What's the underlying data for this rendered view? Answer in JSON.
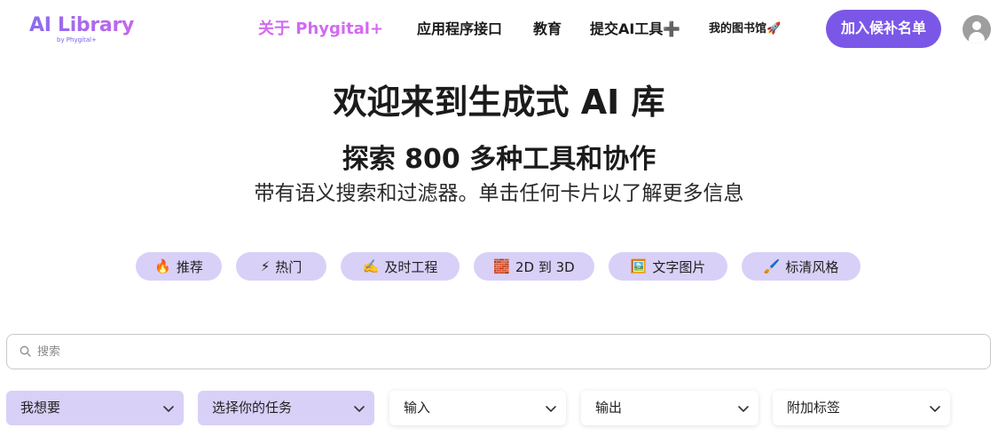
{
  "logo": {
    "title": "AI Library",
    "subtitle": "by Phygital+"
  },
  "nav": {
    "about": "关于 Phygital+",
    "api": "应用程序接口",
    "education": "教育",
    "submit": "提交AI工具",
    "submit_icon": "➕",
    "my_library": "我的图书馆",
    "my_library_icon": "🚀"
  },
  "join_button": "加入候补名单",
  "hero": {
    "title": "欢迎来到生成式 AI 库",
    "subtitle": "探索 800 多种工具和协作",
    "description": "带有语义搜索和过滤器。单击任何卡片以了解更多信息"
  },
  "chips": [
    {
      "icon": "🔥",
      "label": "推荐"
    },
    {
      "icon": "⚡",
      "label": "热门"
    },
    {
      "icon": "✍️",
      "label": "及时工程"
    },
    {
      "icon": "🧱",
      "label": "2D 到 3D"
    },
    {
      "icon": "🖼️",
      "label": "文字图片"
    },
    {
      "icon": "🖌️",
      "label": "标清风格"
    }
  ],
  "search": {
    "placeholder": "搜索",
    "value": ""
  },
  "filters": [
    {
      "label": "我想要"
    },
    {
      "label": "选择你的任务"
    },
    {
      "label": "输入"
    },
    {
      "label": "输出"
    },
    {
      "label": "附加标签"
    }
  ],
  "colors": {
    "accent": "#7b57e8",
    "chip_bg": "#d9d0f8",
    "about_link": "#d36af0"
  }
}
